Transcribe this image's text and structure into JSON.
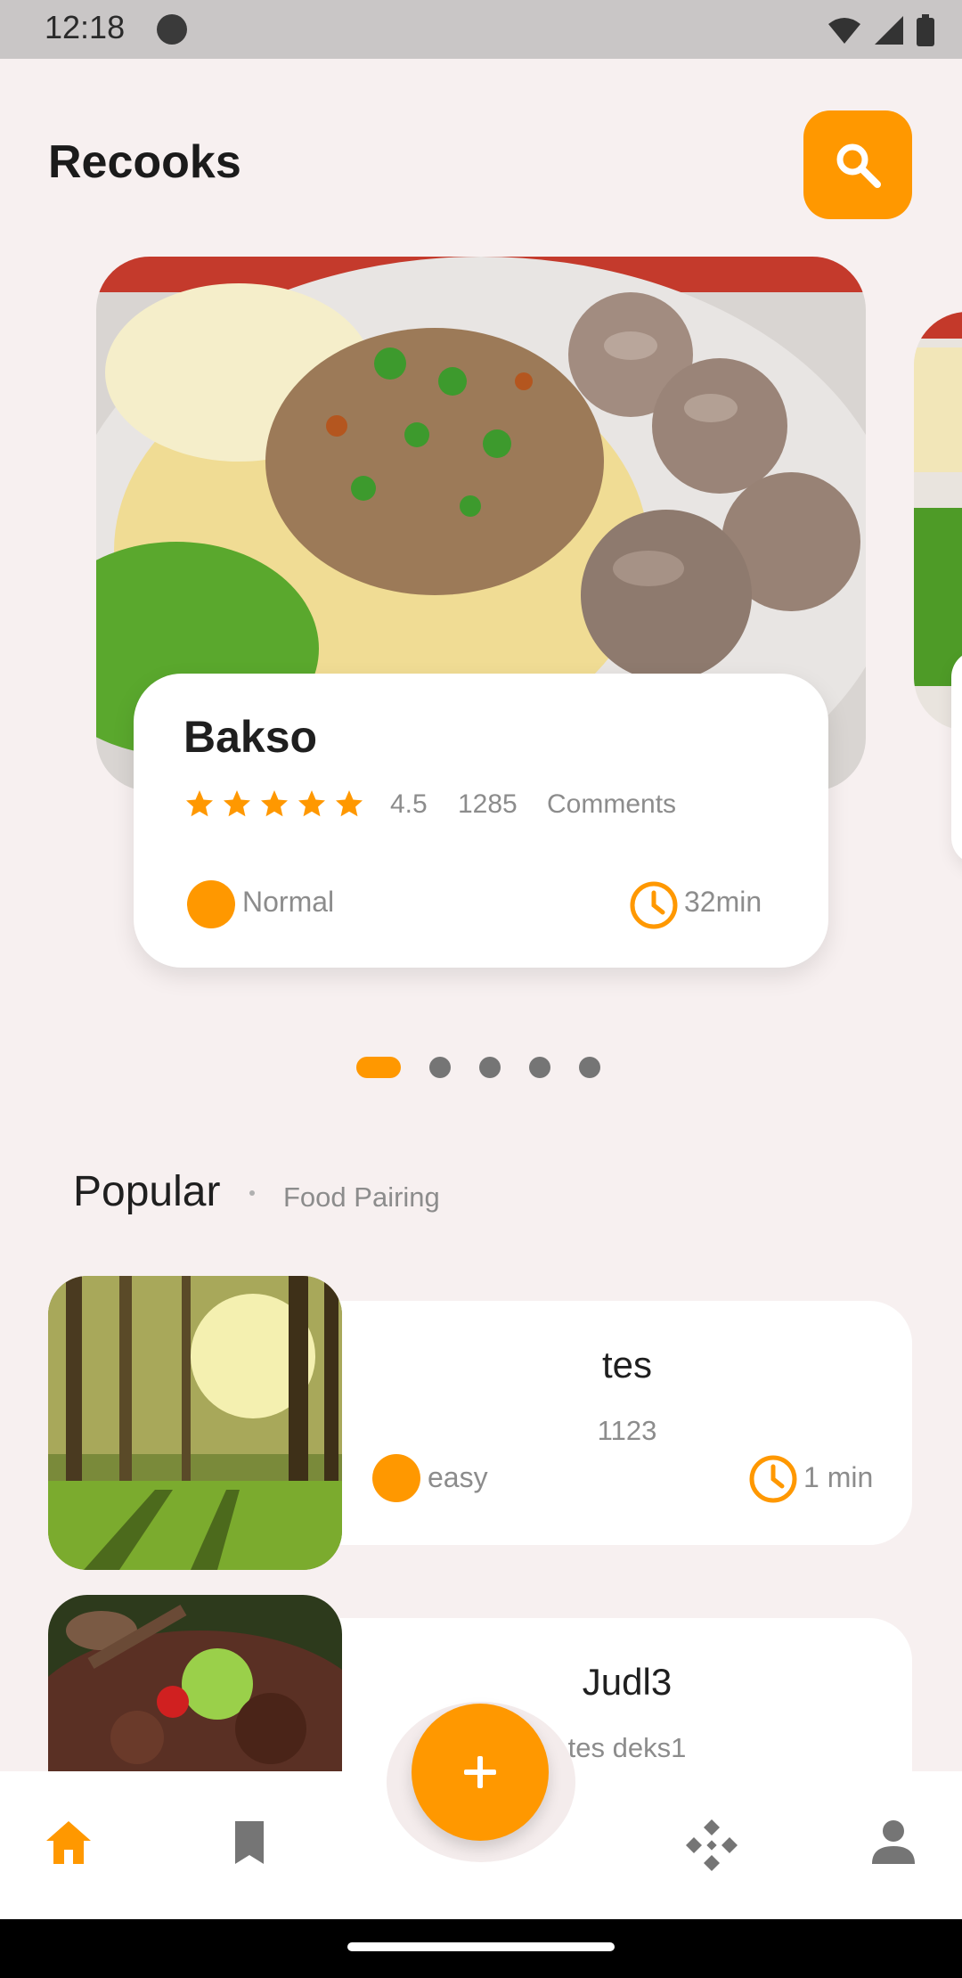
{
  "status_bar": {
    "time": "12:18"
  },
  "header": {
    "title": "Recooks",
    "search_icon": "search-icon"
  },
  "featured": {
    "title": "Bakso",
    "rating": "4.5",
    "stars": 5,
    "comment_count": "1285",
    "comments_label": "Comments",
    "difficulty": "Normal",
    "time": "32min"
  },
  "pager": {
    "count": 5,
    "active_index": 0
  },
  "tabs": {
    "popular": "Popular",
    "food_pairing": "Food Pairing"
  },
  "items": [
    {
      "title": "tes",
      "subtitle": "1123",
      "difficulty": "easy",
      "time": "1 min"
    },
    {
      "title": "Judl3",
      "subtitle": "tes deks1"
    }
  ],
  "bottom_nav": [
    "home-icon",
    "bookmark-icon",
    "add-icon",
    "dashboard-icon",
    "person-icon"
  ],
  "colors": {
    "accent": "#ff9800",
    "background": "#f7f0f0",
    "card": "#ffffff"
  }
}
